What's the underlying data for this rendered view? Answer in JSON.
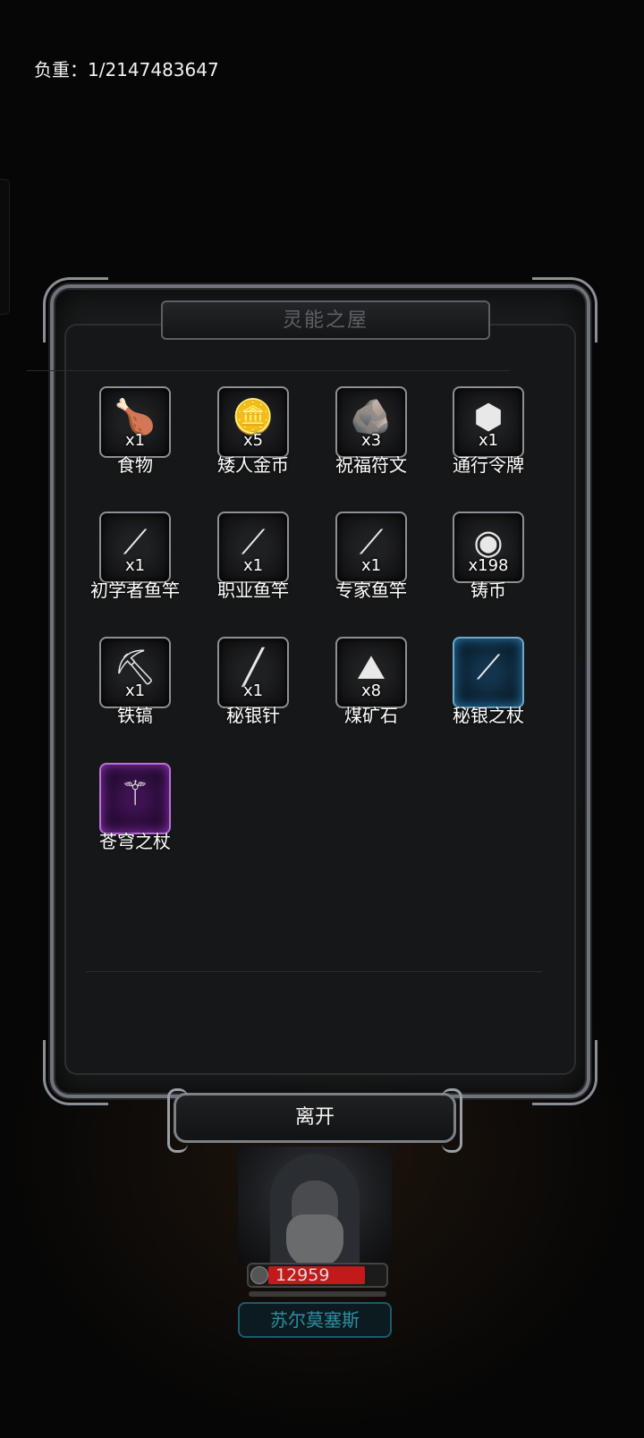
{
  "panel": {
    "title": "灵能之屋",
    "weight_label": "负重：1/2147483647"
  },
  "items": [
    {
      "name": "食物",
      "qty": "x1",
      "icon": "roasted-drumstick-icon",
      "glyph": "🍗",
      "rarity": "normal"
    },
    {
      "name": "矮人金币",
      "qty": "x5",
      "icon": "gold-coin-icon",
      "glyph": "🪙",
      "rarity": "normal"
    },
    {
      "name": "祝福符文",
      "qty": "x3",
      "icon": "rune-stone-icon",
      "glyph": "🪨",
      "rarity": "normal"
    },
    {
      "name": "通行令牌",
      "qty": "x1",
      "icon": "hex-token-icon",
      "glyph": "⬢",
      "rarity": "normal"
    },
    {
      "name": "初学者鱼竿",
      "qty": "x1",
      "icon": "fishing-rod-icon",
      "glyph": "⟋",
      "rarity": "normal"
    },
    {
      "name": "职业鱼竿",
      "qty": "x1",
      "icon": "fishing-rod-icon",
      "glyph": "⟋",
      "rarity": "normal"
    },
    {
      "name": "专家鱼竿",
      "qty": "x1",
      "icon": "fishing-rod-icon",
      "glyph": "⟋",
      "rarity": "normal"
    },
    {
      "name": "铸币",
      "qty": "x198",
      "icon": "minted-coin-icon",
      "glyph": "◉",
      "rarity": "normal"
    },
    {
      "name": "铁镐",
      "qty": "x1",
      "icon": "pickaxe-icon",
      "glyph": "⛏",
      "rarity": "normal"
    },
    {
      "name": "秘银针",
      "qty": "x1",
      "icon": "needle-icon",
      "glyph": "╱",
      "rarity": "normal"
    },
    {
      "name": "煤矿石",
      "qty": "x8",
      "icon": "coal-ore-icon",
      "glyph": "⛰",
      "rarity": "normal"
    },
    {
      "name": "秘银之杖",
      "qty": "",
      "icon": "staff-icon",
      "glyph": "⟋",
      "rarity": "rare"
    },
    {
      "name": "苍穹之杖",
      "qty": "",
      "icon": "staff-icon",
      "glyph": "⚚",
      "rarity": "epic"
    }
  ],
  "leave_button": {
    "label": "离开"
  },
  "character": {
    "hp": "12959",
    "hp_fraction": 0.72,
    "name": "苏尔莫塞斯"
  },
  "colors": {
    "rare_border": "#6fa8c7",
    "epic_border": "#b873d3",
    "hp_bar": "#c21a1a",
    "name_text": "#2f8ea3"
  }
}
